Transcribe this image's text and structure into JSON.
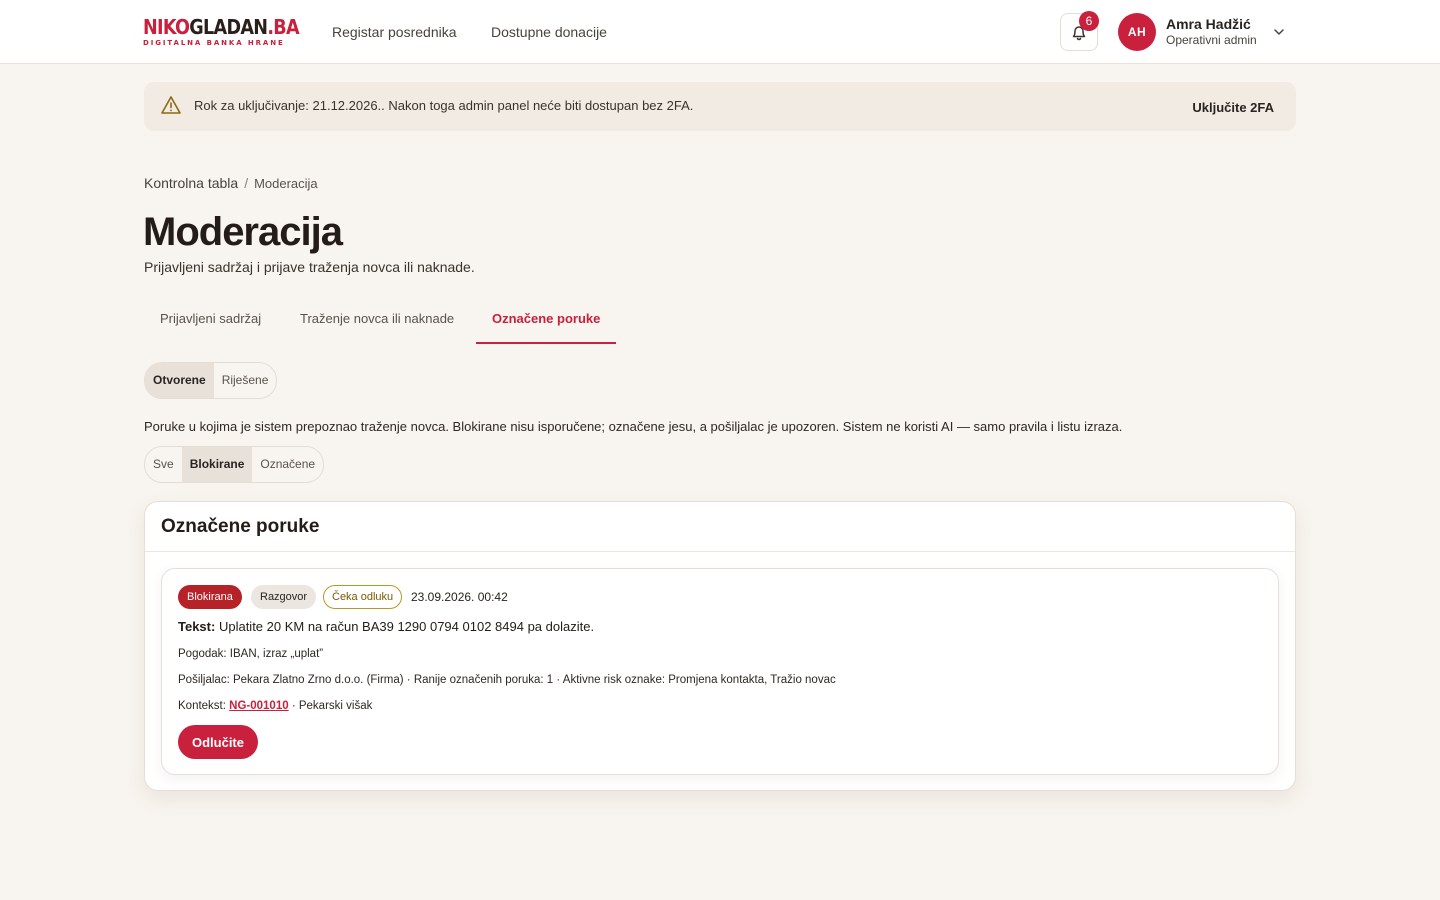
{
  "brand": {
    "logo_red": "NIKO",
    "logo_dark": "GLADAN",
    "logo_tail": ".BA",
    "logo_sub": "DIGITALNA BANKA HRANE",
    "accent": "#c8203d"
  },
  "nav": {
    "items": [
      {
        "label": "Registar posrednika"
      },
      {
        "label": "Dostupne donacije"
      }
    ]
  },
  "notifications": {
    "icon": "bell-icon",
    "count": "6"
  },
  "user": {
    "initials": "AH",
    "name": "Amra Hadžić",
    "role": "Operativni admin"
  },
  "alert": {
    "icon": "warning-triangle-icon",
    "text": "Rok za uključivanje: 21.12.2026.. Nakon toga admin panel neće biti dostupan bez 2FA.",
    "action": "Uključite 2FA"
  },
  "breadcrumb": {
    "home": "Kontrolna tabla",
    "separator": "/",
    "current": "Moderacija"
  },
  "page": {
    "title": "Moderacija",
    "subtitle": "Prijavljeni sadržaj i prijave traženja novca ili naknade."
  },
  "tabs": [
    {
      "label": "Prijavljeni sadržaj"
    },
    {
      "label": "Traženje novca ili naknade"
    },
    {
      "label": "Označene poruke",
      "active": true
    }
  ],
  "status_filter": {
    "options": [
      "Otvorene",
      "Riješene"
    ],
    "selected": "Otvorene"
  },
  "description": "Poruke u kojima je sistem prepoznao traženje novca. Blokirane nisu isporučene; označene jesu, a pošiljalac je upozoren. Sistem ne koristi AI — samo pravila i listu izraza.",
  "type_filter": {
    "options": [
      "Sve",
      "Blokirane",
      "Označene"
    ],
    "selected": "Blokirane"
  },
  "card": {
    "title": "Označene poruke",
    "items": [
      {
        "badges": [
          "Blokirana",
          "Razgovor",
          "Čeka odluku"
        ],
        "datetime": "23.09.2026. 00:42",
        "text_label": "Tekst:",
        "text": "Uplatite 20 KM na račun BA39 1290 0794 0102 8494 pa dolazite.",
        "match": "Pogodak: IBAN, izraz „uplat”",
        "sender": "Pošiljalac: Pekara Zlatno Zrno d.o.o. (Firma) · Ranije označenih poruka: 1 · Aktivne risk oznake: Promjena kontakta, Tražio novac",
        "context_label": "Kontekst:",
        "context_link": "NG-001010",
        "context_rest": "· Pekarski višak",
        "action": "Odlučite"
      }
    ]
  }
}
